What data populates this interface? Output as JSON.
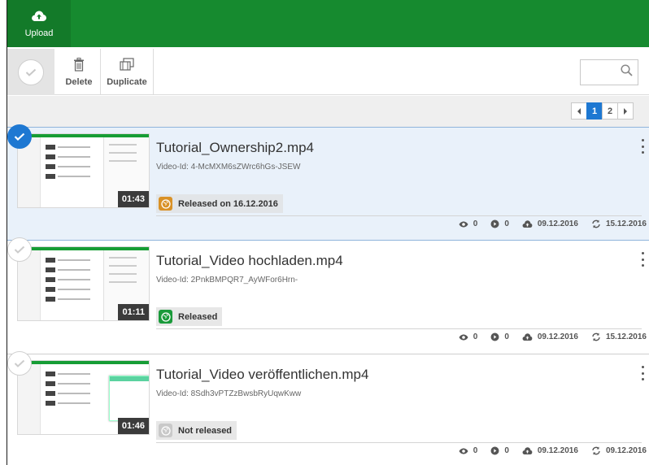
{
  "topbar": {
    "upload_label": "Upload"
  },
  "toolbar": {
    "delete_label": "Delete",
    "duplicate_label": "Duplicate",
    "search_placeholder": ""
  },
  "pagination": {
    "pages": [
      "1",
      "2"
    ],
    "current": "1"
  },
  "colors": {
    "brand_green": "#168a2f",
    "accent_blue": "#1e78d2",
    "released_green": "#1a9a3a",
    "scheduled_orange": "#d99126",
    "not_released_grey": "#c9c9c9"
  },
  "videos": [
    {
      "title": "Tutorial_Ownership2.mp4",
      "video_id": "Video-Id: 4-McMXM6sZWrc6hGs-JSEW",
      "duration": "01:43",
      "status": "Released on 16.12.2016",
      "status_icon": "globe-schedule-icon",
      "views": "0",
      "plays": "0",
      "uploaded": "09.12.2016",
      "updated": "15.12.2016",
      "selected": true
    },
    {
      "title": "Tutorial_Video hochladen.mp4",
      "video_id": "Video-Id: 2PnkBMPQR7_AyWFor6Hrn-",
      "duration": "01:11",
      "status": "Released",
      "status_icon": "globe-icon",
      "views": "0",
      "plays": "0",
      "uploaded": "09.12.2016",
      "updated": "15.12.2016",
      "selected": false
    },
    {
      "title": "Tutorial_Video veröffentlichen.mp4",
      "video_id": "Video-Id: 8Sdh3vPTZzBwsbRyUqwKww",
      "duration": "01:46",
      "status": "Not released",
      "status_icon": "globe-disabled-icon",
      "views": "0",
      "plays": "0",
      "uploaded": "09.12.2016",
      "updated": "09.12.2016",
      "selected": false
    }
  ]
}
